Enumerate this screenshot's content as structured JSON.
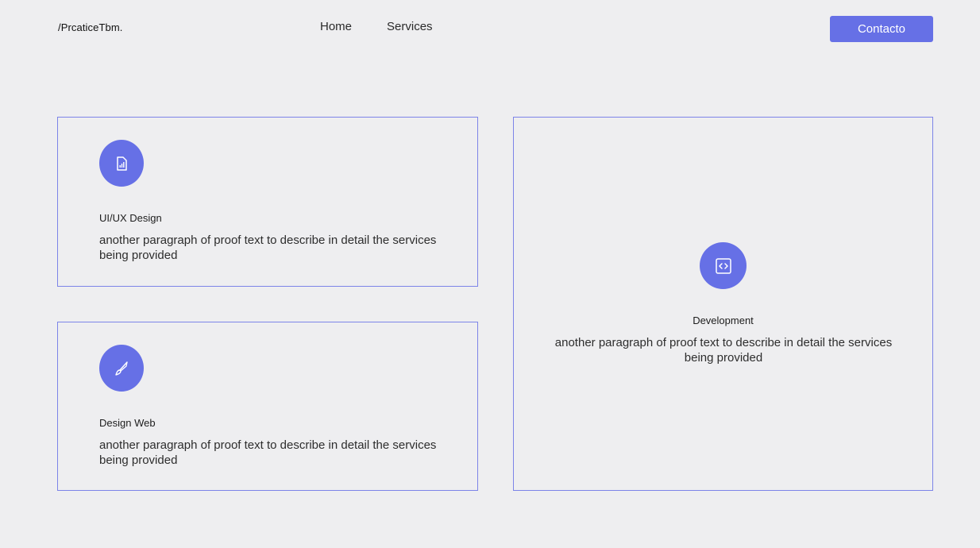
{
  "header": {
    "logo": "/PrcaticeTbm.",
    "nav": [
      {
        "label": "Home"
      },
      {
        "label": "Services"
      }
    ],
    "contact_label": "Contacto"
  },
  "colors": {
    "accent": "#6670e6",
    "border": "#7c84e8",
    "background": "#eeeef0"
  },
  "services": [
    {
      "title": "UI/UX Design",
      "text": "another paragraph of proof text to describe in detail the services being provided",
      "icon": "chart-document-icon"
    },
    {
      "title": "Design Web",
      "text": "another paragraph of proof text to describe in detail the services being provided",
      "icon": "brush-icon"
    },
    {
      "title": "Development",
      "text": "another paragraph of proof text to describe in detail the services being provided",
      "icon": "code-icon"
    }
  ]
}
